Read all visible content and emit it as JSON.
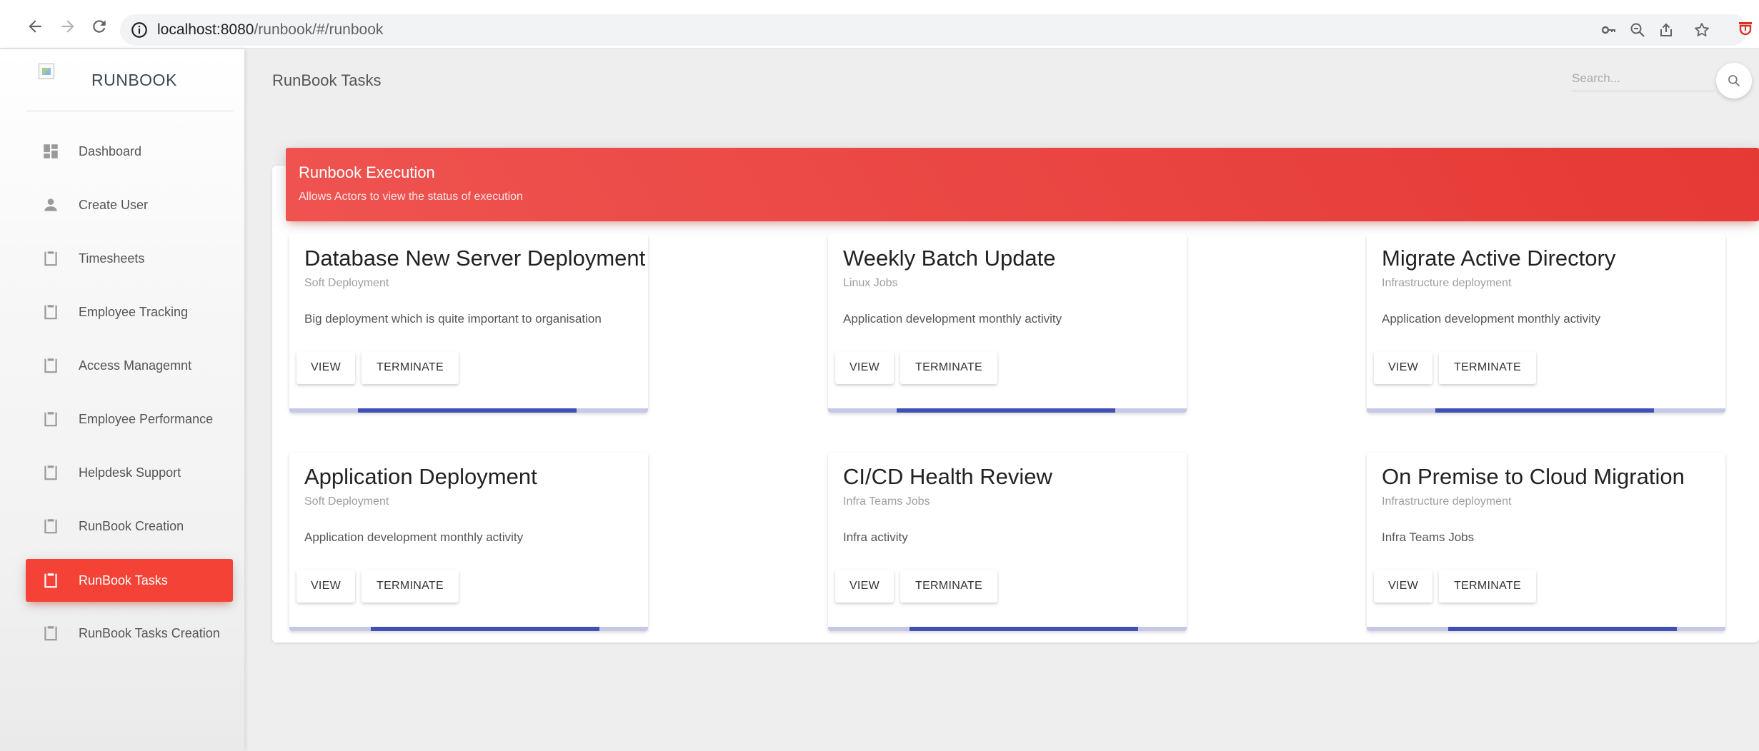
{
  "browser": {
    "url_host": "localhost:8080",
    "url_path": "/runbook/#/runbook"
  },
  "sidebar": {
    "brand": "RUNBOOK",
    "items": [
      {
        "label": "Dashboard",
        "icon": "dashboard-icon",
        "active": false
      },
      {
        "label": "Create User",
        "icon": "person-icon",
        "active": false
      },
      {
        "label": "Timesheets",
        "icon": "clipboard-icon",
        "active": false
      },
      {
        "label": "Employee Tracking",
        "icon": "clipboard-icon",
        "active": false
      },
      {
        "label": "Access Managemnt",
        "icon": "clipboard-icon",
        "active": false
      },
      {
        "label": "Employee Performance",
        "icon": "clipboard-icon",
        "active": false
      },
      {
        "label": "Helpdesk Support",
        "icon": "clipboard-icon",
        "active": false
      },
      {
        "label": "RunBook Creation",
        "icon": "clipboard-icon",
        "active": false
      },
      {
        "label": "RunBook Tasks",
        "icon": "clipboard-icon",
        "active": true
      },
      {
        "label": "RunBook Tasks Creation",
        "icon": "clipboard-icon",
        "active": false
      }
    ]
  },
  "navbar": {
    "title": "RunBook Tasks",
    "search_placeholder": "Search..."
  },
  "colors": {
    "accent": "#f44336",
    "progress": "#3f51b5",
    "progress_track": "#c5c8e6"
  },
  "execution": {
    "title": "Runbook Execution",
    "subtitle": "Allows Actors to view the status of execution",
    "view_label": "VIEW",
    "terminate_label": "TERMINATE",
    "tasks": [
      {
        "title": "Database New Server Deployment",
        "type": "Soft Deployment",
        "description": "Big deployment which is quite important to organisation"
      },
      {
        "title": "Weekly Batch Update",
        "type": "Linux Jobs",
        "description": "Application development monthly activity"
      },
      {
        "title": "Migrate Active Directory",
        "type": "Infrastructure deployment",
        "description": "Application development monthly activity"
      },
      {
        "title": "Application Deployment",
        "type": "Soft Deployment",
        "description": "Application development monthly activity"
      },
      {
        "title": "CI/CD Health Review",
        "type": "Infra Teams Jobs",
        "description": "Infra activity"
      },
      {
        "title": "On Premise to Cloud Migration",
        "type": "Infrastructure deployment",
        "description": "Infra Teams Jobs"
      }
    ]
  }
}
